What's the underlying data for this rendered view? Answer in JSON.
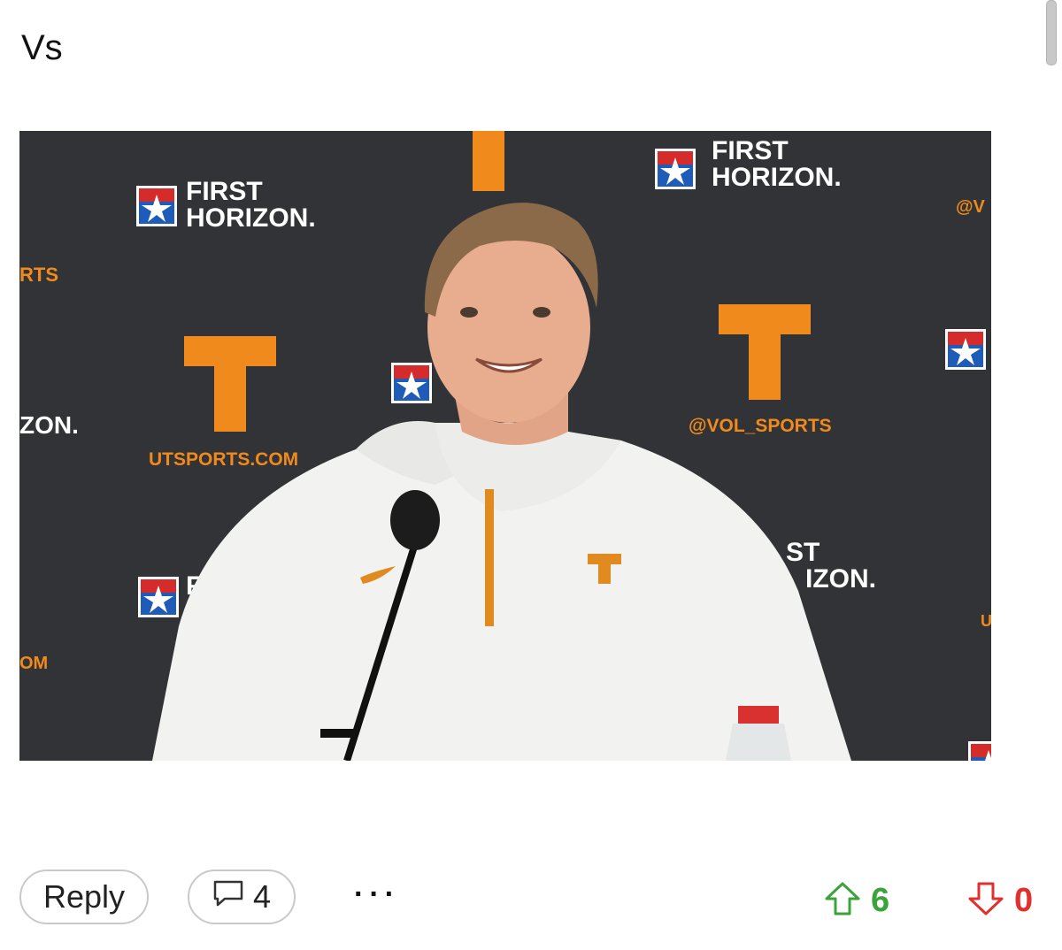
{
  "post": {
    "text": "Vs"
  },
  "image": {
    "backdrop_sponsor_line1": "FIRST",
    "backdrop_sponsor_line2": "HORIZON.",
    "backdrop_url": "UTSPORTS.COM",
    "backdrop_handle": "@VOL_SPORTS",
    "backdrop_logo_letter": "T",
    "partial_texts": [
      "RTS",
      "ZON.",
      "OM",
      "@V",
      "ST",
      "IZON.",
      "U"
    ]
  },
  "actions": {
    "reply_label": "Reply",
    "comment_count": "4",
    "more_label": "···",
    "upvote_count": "6",
    "downvote_count": "0"
  },
  "colors": {
    "tennessee_orange": "#f08a1c",
    "backdrop": "#2f3033",
    "upvote": "#3aa33a",
    "downvote": "#e03030"
  }
}
